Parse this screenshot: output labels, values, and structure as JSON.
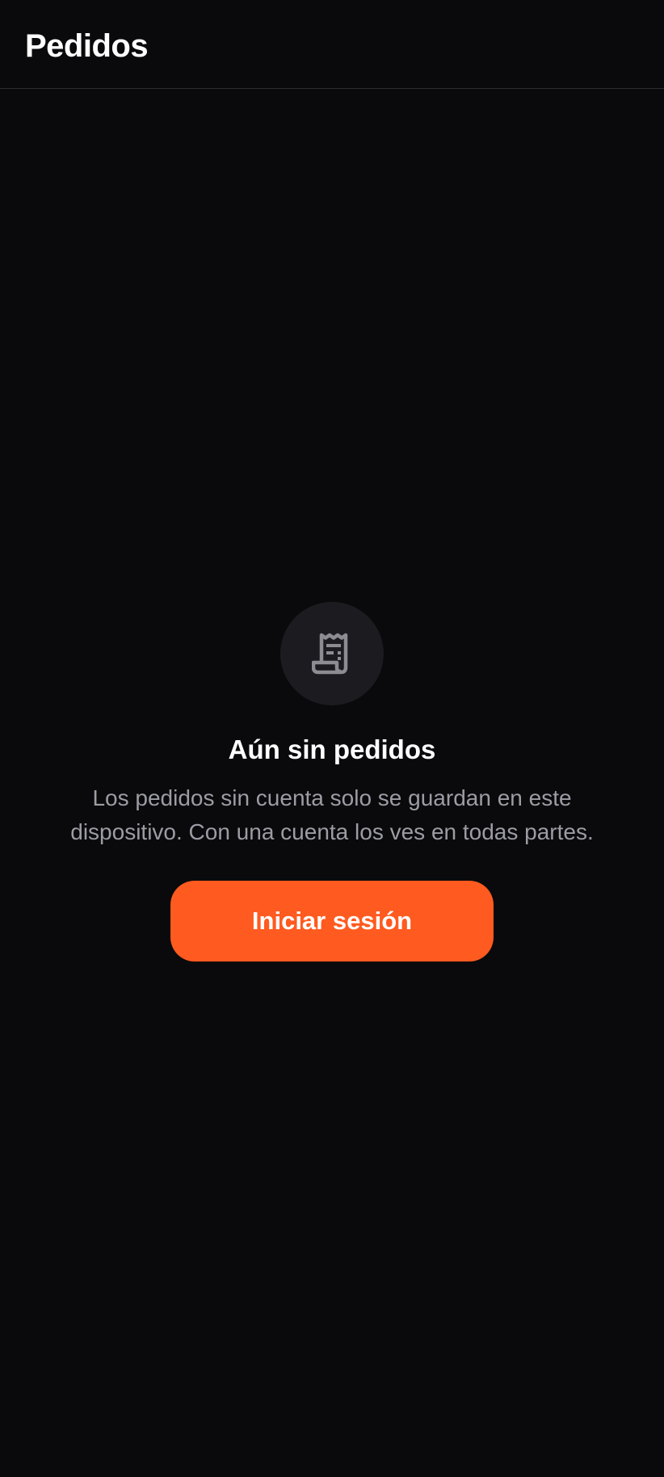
{
  "header": {
    "title": "Pedidos"
  },
  "empty_state": {
    "icon": "receipt-icon",
    "title": "Aún sin pedidos",
    "description": "Los pedidos sin cuenta solo se guardan en este dispositivo. Con una cuenta los ves en todas partes.",
    "button_label": "Iniciar sesión"
  },
  "colors": {
    "background": "#0a0a0c",
    "accent": "#ff5a1f",
    "icon_circle": "#1c1c20",
    "muted_text": "#9c9ca4"
  }
}
